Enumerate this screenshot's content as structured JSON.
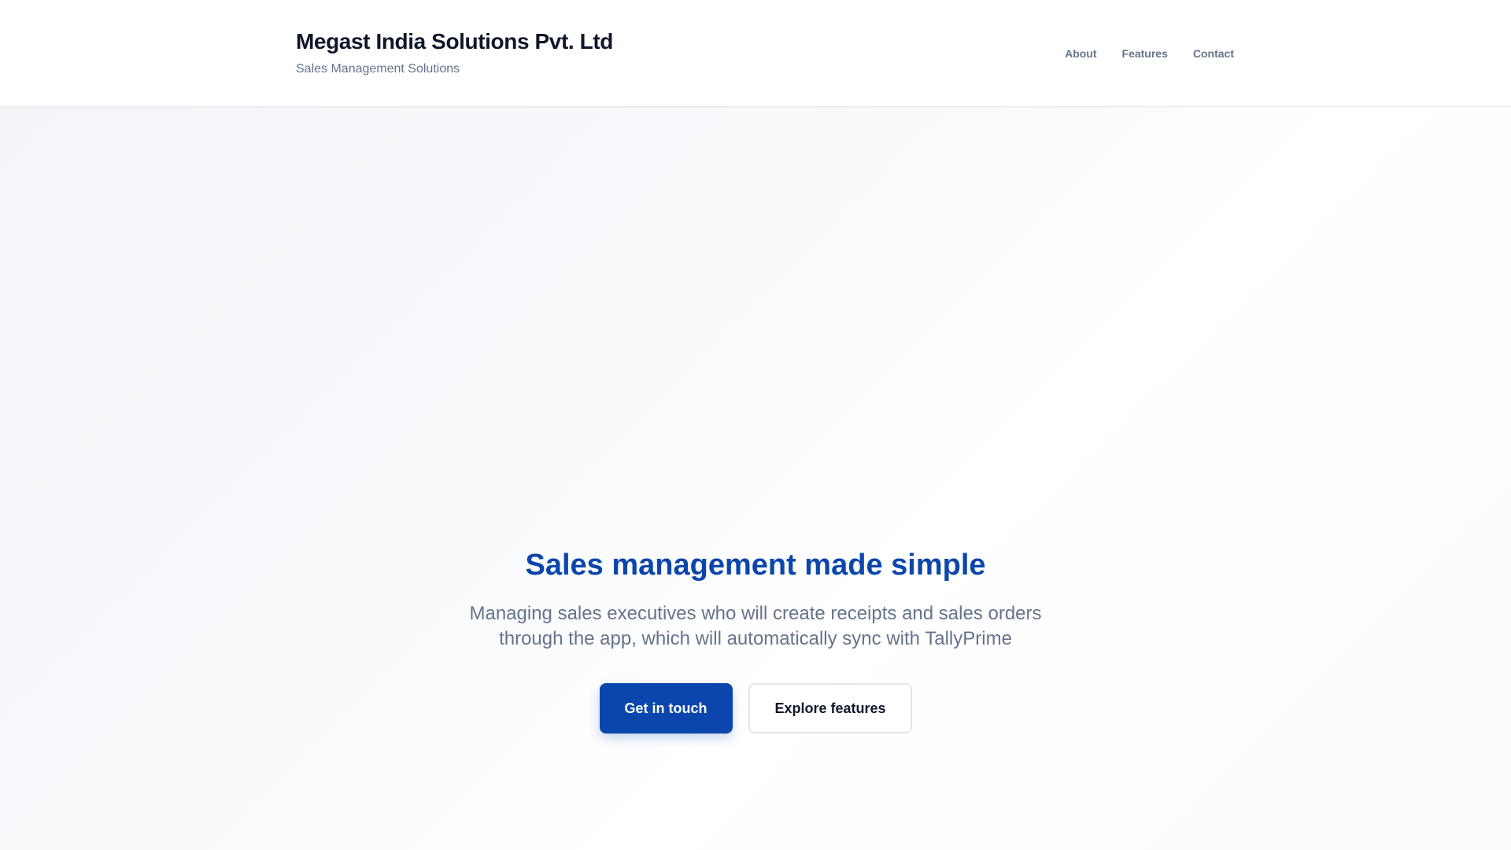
{
  "header": {
    "brand_name": "Megast India Solutions Pvt. Ltd",
    "tagline": "Sales Management Solutions",
    "nav": [
      {
        "label": "About"
      },
      {
        "label": "Features"
      },
      {
        "label": "Contact"
      }
    ]
  },
  "hero": {
    "title": "Sales management made simple",
    "subtitle": "Managing sales executives who will create receipts and sales orders through the app, which will automatically sync with TallyPrime",
    "primary_button": "Get in touch",
    "secondary_button": "Explore features"
  },
  "colors": {
    "brand_blue": "#0b46ac",
    "text_dark": "#0f172a",
    "text_muted": "#64748b"
  }
}
